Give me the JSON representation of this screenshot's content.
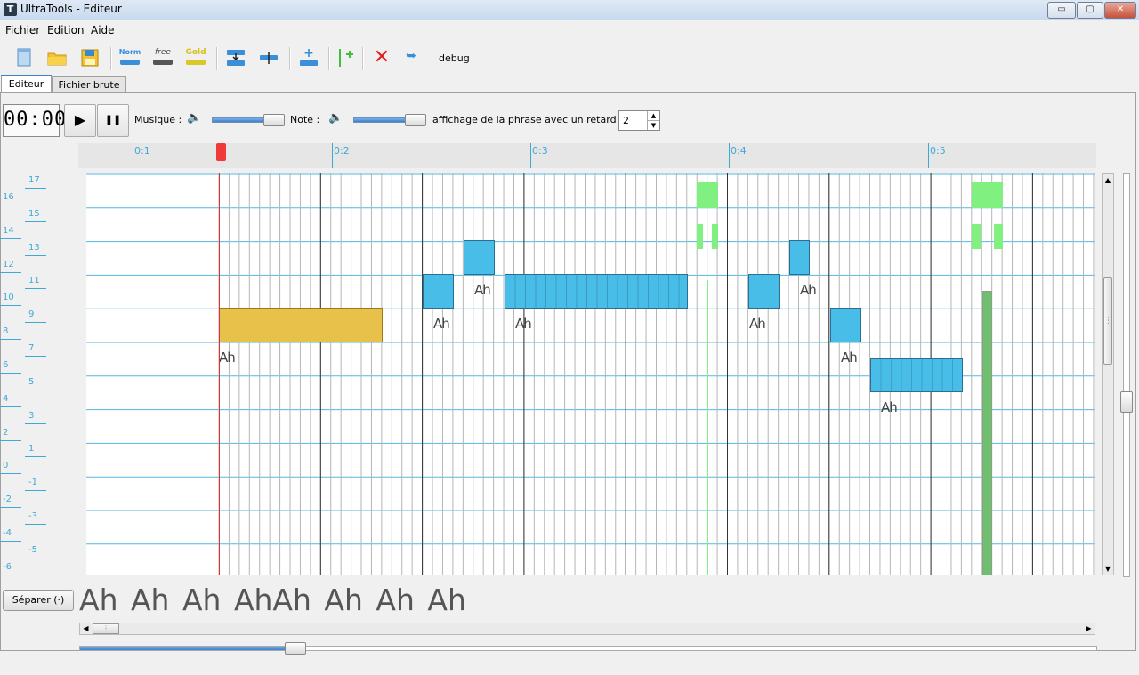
{
  "window": {
    "title": "UltraTools - Editeur",
    "app_icon_glyph": "T",
    "minimize_glyph": "▭",
    "maximize_glyph": "▢",
    "close_glyph": "✕"
  },
  "menu": [
    "Fichier",
    "Edition",
    "Aide"
  ],
  "toolbar": {
    "icons": [
      "new-file-icon",
      "open-folder-icon",
      "save-icon",
      "norm-icon",
      "free-icon",
      "gold-icon",
      "insert-below-icon",
      "split-icon",
      "add-note-icon",
      "add-green-icon",
      "delete-icon",
      "redo-icon"
    ],
    "norm_label": "Norm",
    "free_label": "free",
    "gold_label": "Gold",
    "debug_label": "debug",
    "delete_glyph": "✕",
    "redo_glyph": "➥",
    "add_glyph": "+"
  },
  "tabs": [
    "Editeur",
    "Fichier brute"
  ],
  "controls": {
    "timer": "00:00",
    "play_glyph": "▶",
    "pause_glyph": "❚❚",
    "music_label": "Musique :",
    "note_label": "Note :",
    "speaker_glyph": "🔈",
    "delay_label": "affichage de la phrase avec un retard de :",
    "delay_value": "2",
    "spin_up": "▲",
    "spin_down": "▼"
  },
  "timeline": {
    "labels": [
      "0:1",
      "0:2",
      "0:3",
      "0:4",
      "0:5"
    ]
  },
  "pitch_labels": [
    "17",
    "16",
    "15",
    "14",
    "13",
    "12",
    "11",
    "10",
    "9",
    "8",
    "7",
    "6",
    "5",
    "4",
    "3",
    "2",
    "1",
    "0",
    "-1",
    "-2",
    "-3",
    "-4",
    "-5",
    "-6"
  ],
  "notes_lyric": "Ah",
  "lyrics_line": "Ah Ah Ah AhAh Ah Ah Ah",
  "separate_button": "Séparer (·)",
  "scroll": {
    "up": "▲",
    "down": "▼",
    "left": "◀",
    "right": "▶",
    "grip": "⋮"
  },
  "colors": {
    "note_blue": "#48bde8",
    "note_gold": "#e8c14a",
    "note_green": "#80f080",
    "cursor_red": "#e03030",
    "accent": "#3fa9d6"
  }
}
